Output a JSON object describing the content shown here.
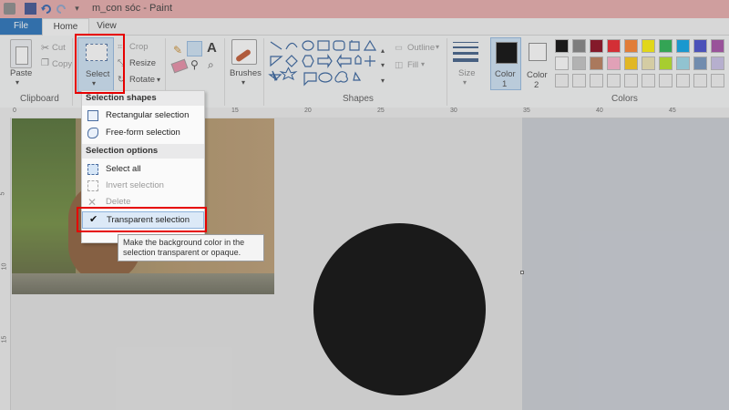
{
  "window": {
    "title": "m_con sóc - Paint"
  },
  "tabs": [
    {
      "label": "File"
    },
    {
      "label": "Home"
    },
    {
      "label": "View"
    }
  ],
  "clipboard": {
    "paste_label": "Paste",
    "cut_label": "Cut",
    "copy_label": "Copy",
    "group_label": "Clipboard"
  },
  "image": {
    "select_label": "Select",
    "crop_label": "Crop",
    "resize_label": "Resize",
    "rotate_label": "Rotate"
  },
  "tools": {
    "group_label_fragment": "s"
  },
  "brushes": {
    "label": "Brushes"
  },
  "shapes": {
    "group_label": "Shapes",
    "outline_label": "Outline",
    "fill_label": "Fill"
  },
  "size": {
    "label": "Size"
  },
  "color1": {
    "label": "Color",
    "number": "1"
  },
  "color2": {
    "label": "Color",
    "number": "2"
  },
  "colors": {
    "group_label": "Colors",
    "row1": [
      "#000000",
      "#7f7f7f",
      "#880015",
      "#ed1c24",
      "#ff7f27",
      "#fff200",
      "#22b14c",
      "#00a2e8",
      "#3f48cc",
      "#a349a4"
    ],
    "row2": [
      "#ffffff",
      "#c3c3c3",
      "#b97a57",
      "#ffaec9",
      "#ffc90e",
      "#efe4b0",
      "#b5e61d",
      "#99d9ea",
      "#7092be",
      "#c8bfe7"
    ]
  },
  "ruler": {
    "ticks": [
      "0",
      "5",
      "10",
      "15",
      "20",
      "25",
      "30",
      "35",
      "40",
      "45"
    ],
    "vticks": [
      "5",
      "10",
      "15"
    ]
  },
  "menu": {
    "shapes_header": "Selection shapes",
    "rect_label": "Rectangular selection",
    "free_label": "Free-form selection",
    "options_header": "Selection options",
    "select_all_label": "Select all",
    "invert_label": "Invert selection",
    "delete_label": "Delete",
    "transparent_label": "Transparent selection",
    "checkmark": "✔"
  },
  "tooltip": {
    "line1": "Make the background color in the",
    "line2": "selection transparent or opaque."
  }
}
